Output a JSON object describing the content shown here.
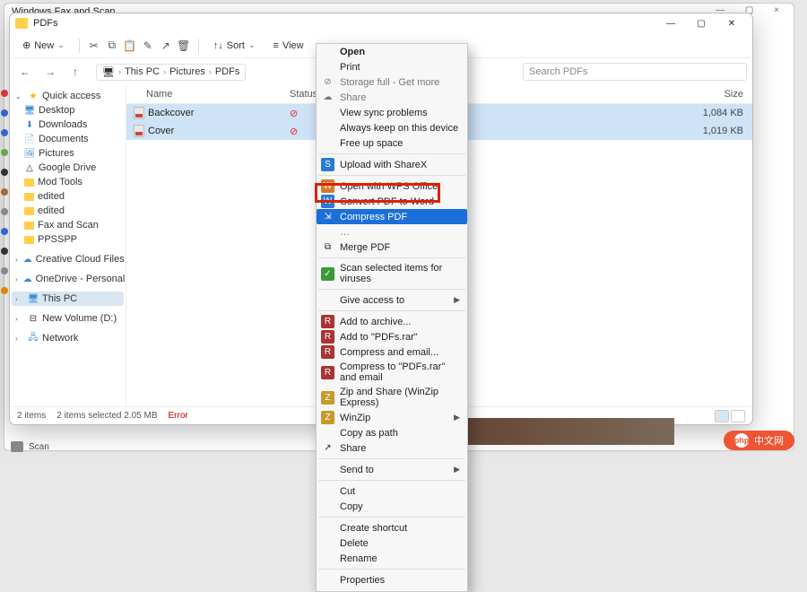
{
  "bg_window": {
    "title": "Windows Fax and Scan"
  },
  "window": {
    "title": "PDFs"
  },
  "toolbar": {
    "new": "New",
    "sort": "Sort",
    "view": "View"
  },
  "nav": {
    "crumbs": [
      "This PC",
      "Pictures",
      "PDFs"
    ],
    "search_placeholder": "Search PDFs"
  },
  "sidebar": {
    "quick_access": "Quick access",
    "items": [
      {
        "label": "Desktop"
      },
      {
        "label": "Downloads"
      },
      {
        "label": "Documents"
      },
      {
        "label": "Pictures"
      },
      {
        "label": "Google Drive"
      },
      {
        "label": "Mod Tools"
      },
      {
        "label": "edited"
      },
      {
        "label": "edited"
      },
      {
        "label": "Fax and Scan"
      },
      {
        "label": "PPSSPP"
      },
      {
        "label": "Creative Cloud Files"
      },
      {
        "label": "OneDrive - Personal"
      }
    ],
    "this_pc": "This PC",
    "new_volume": "New Volume (D:)",
    "network": "Network"
  },
  "columns": {
    "name": "Name",
    "status": "Status",
    "size": "Size"
  },
  "rows": [
    {
      "name": "Backcover",
      "size": "1,084 KB"
    },
    {
      "name": "Cover",
      "size": "1,019 KB"
    }
  ],
  "status": {
    "items": "2 items",
    "selection": "2 items selected  2.05 MB",
    "error": "Error"
  },
  "context_menu": {
    "open": "Open",
    "print": "Print",
    "storage_full": "Storage full - Get more",
    "share_od": "Share",
    "view_sync": "View sync problems",
    "always_keep": "Always keep on this device",
    "free_up": "Free up space",
    "sharex": "Upload with ShareX",
    "wps": "Open with WPS Office",
    "convert_word": "Convert PDF to Word",
    "compress_pdf": "Compress PDF",
    "trunc": "…",
    "merge": "Merge PDF",
    "scan_virus": "Scan selected items for viruses",
    "give_access": "Give access to",
    "add_archive": "Add to archive...",
    "add_pdfs_rar": "Add to \"PDFs.rar\"",
    "compress_email": "Compress and email...",
    "compress_pdfs_email": "Compress to \"PDFs.rar\" and email",
    "zip_share": "Zip and Share (WinZip Express)",
    "winzip": "WinZip",
    "copy_path": "Copy as path",
    "share": "Share",
    "send_to": "Send to",
    "cut": "Cut",
    "copy": "Copy",
    "create_shortcut": "Create shortcut",
    "delete": "Delete",
    "rename": "Rename",
    "properties": "Properties"
  },
  "bottom_left": {
    "label": "Scan"
  },
  "watermark": "中文网"
}
